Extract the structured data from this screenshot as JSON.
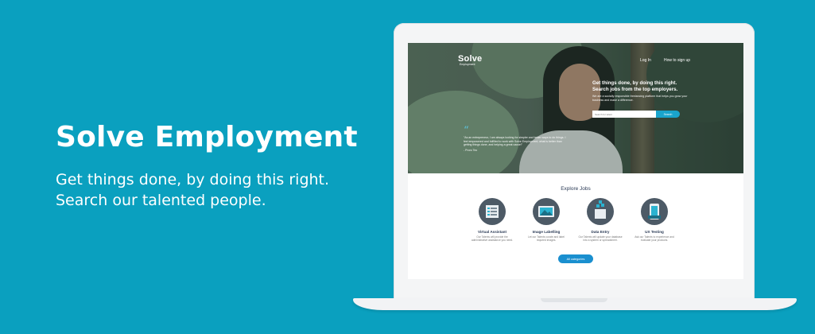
{
  "banner": {
    "title": "Solve Employment",
    "subtitle_line1": "Get things done, by doing this right.",
    "subtitle_line2": "Search our talented people."
  },
  "website": {
    "logo": {
      "name": "Solve",
      "tagline": "Employment"
    },
    "nav": {
      "login": "Log In",
      "signup": "How to sign up"
    },
    "hero": {
      "heading_line1": "Get things done, by doing this right.",
      "heading_line2": "Search jobs from the top employers.",
      "body": "We are a socially responsible freelancing platform that helps you grow your business and make a difference.",
      "search_placeholder": "Search for talent",
      "search_button": "Search"
    },
    "quote": {
      "text": "\"As an entrepreneur, I am always looking for simpler and better ways to do things. I feel empowered and fulfilled to work with Solve Employment; what is better than getting things done, and helping a great cause!\"",
      "author": "- Proro Teo"
    },
    "explore": {
      "title": "Explore Jobs",
      "jobs": [
        {
          "title": "Virtual Assistant",
          "desc": "Our Talents will provide the administrative assistance you need.",
          "icon": "checklist-icon"
        },
        {
          "title": "Image Labelling",
          "desc": "Let our Talents curate and label required images.",
          "icon": "image-icon"
        },
        {
          "title": "Data Entry",
          "desc": "Our Talents will update your database into a system or spreadsheet.",
          "icon": "data-box-icon"
        },
        {
          "title": "UX Testing",
          "desc": "Ask our Talents to experience and evaluate your products.",
          "icon": "mobile-test-icon"
        }
      ],
      "all_button": "All categories"
    }
  },
  "colors": {
    "background": "#0aa0bf",
    "accent": "#1a8fcf",
    "icon_circle": "#4d5a66"
  }
}
